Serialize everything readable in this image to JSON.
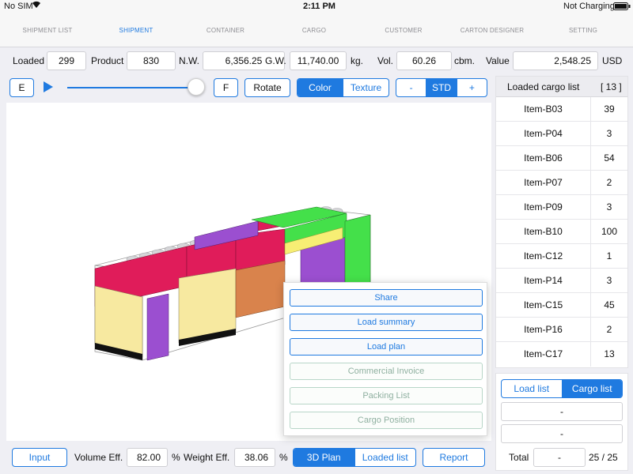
{
  "status": {
    "carrier": "No SIM",
    "time": "2:11 PM",
    "battery": "Not Charging"
  },
  "nav": {
    "tabs": [
      {
        "label": "SHIPMENT LIST",
        "active": false
      },
      {
        "label": "SHIPMENT",
        "active": true
      },
      {
        "label": "CONTAINER",
        "active": false
      },
      {
        "label": "CARGO",
        "active": false
      },
      {
        "label": "CUSTOMER",
        "active": false
      },
      {
        "label": "CARTON DESIGNER",
        "active": false
      },
      {
        "label": "SETTING",
        "active": false
      }
    ]
  },
  "summary": {
    "loaded_label": "Loaded",
    "loaded_value": "299",
    "product_label": "Product",
    "product_value": "830",
    "nw_label": "N.W.",
    "nw_value": "6,356.25",
    "gw_label": "G.W.",
    "gw_value": "11,740.00",
    "weight_unit": "kg.",
    "vol_label": "Vol.",
    "vol_value": "60.26",
    "vol_unit": "cbm.",
    "value_label": "Value",
    "value_value": "2,548.25",
    "currency": "USD"
  },
  "toolbar": {
    "e_label": "E",
    "f_label": "F",
    "rotate_label": "Rotate",
    "color_label": "Color",
    "texture_label": "Texture",
    "minus_label": "-",
    "std_label": "STD",
    "plus_label": "+",
    "slider_fraction": 1.0
  },
  "popup": {
    "items": [
      {
        "label": "Share",
        "enabled": true
      },
      {
        "label": "Load summary",
        "enabled": true
      },
      {
        "label": "Load plan",
        "enabled": true
      },
      {
        "label": "Commercial Invoice",
        "enabled": false
      },
      {
        "label": "Packing List",
        "enabled": false
      },
      {
        "label": "Cargo Position",
        "enabled": false
      }
    ]
  },
  "cargo_list": {
    "title": "Loaded cargo list",
    "count": "[ 13 ]",
    "rows": [
      {
        "name": "Item-B03",
        "qty": "39"
      },
      {
        "name": "Item-P04",
        "qty": "3"
      },
      {
        "name": "Item-B06",
        "qty": "54"
      },
      {
        "name": "Item-P07",
        "qty": "2"
      },
      {
        "name": "Item-P09",
        "qty": "3"
      },
      {
        "name": "Item-B10",
        "qty": "100"
      },
      {
        "name": "Item-C12",
        "qty": "1"
      },
      {
        "name": "Item-P14",
        "qty": "3"
      },
      {
        "name": "Item-C15",
        "qty": "45"
      },
      {
        "name": "Item-P16",
        "qty": "2"
      },
      {
        "name": "Item-C17",
        "qty": "13"
      }
    ]
  },
  "list_toggle": {
    "load_list": "Load list",
    "cargo_list": "Cargo list"
  },
  "list_footer": {
    "dash1": "-",
    "dash2": "-",
    "total_label": "Total",
    "total_value": "-",
    "total_count": "25 / 25"
  },
  "bottom": {
    "input_label": "Input",
    "vol_eff_label": "Volume Eff.",
    "vol_eff_value": "82.00",
    "pct1": "%",
    "weight_eff_label": "Weight Eff.",
    "weight_eff_value": "38.06",
    "pct2": "%",
    "plan_label": "3D Plan",
    "loaded_list_label": "Loaded list",
    "report_label": "Report"
  },
  "colors": {
    "accent": "#1f7ae0",
    "crimson": "#e01c5a",
    "purple": "#9b4fd0",
    "green": "#44e04a",
    "yellow": "#f7ee74",
    "cream": "#f7e9a0",
    "orange": "#d9834c"
  }
}
